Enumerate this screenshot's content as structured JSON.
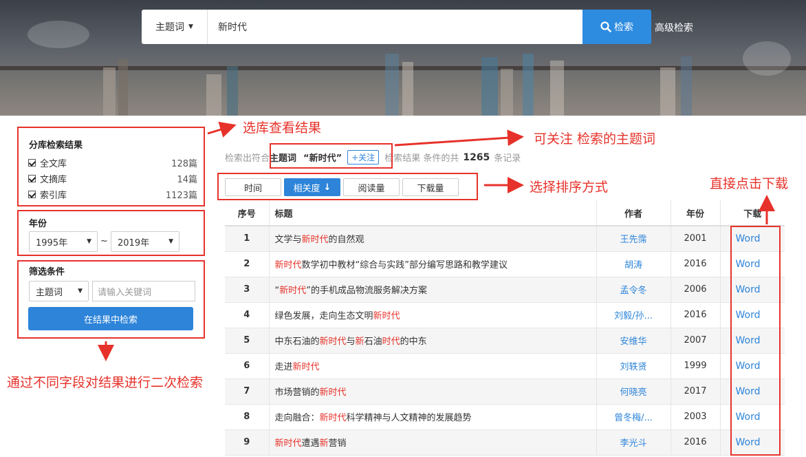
{
  "header": {
    "field_label": "主题词",
    "query": "新时代",
    "search_label": "检索",
    "advanced_label": "高级检索"
  },
  "left": {
    "lib_title": "分库检索结果",
    "libs": [
      {
        "label": "全文库",
        "count": "128篇",
        "checked": true
      },
      {
        "label": "文摘库",
        "count": "14篇",
        "checked": true
      },
      {
        "label": "索引库",
        "count": "1123篇",
        "checked": true
      }
    ],
    "year_title": "年份",
    "year_from": "1995年",
    "year_to": "2019年",
    "year_sep": "~",
    "filter_title": "筛选条件",
    "filter_field": "主题词",
    "filter_placeholder": "请输入关键词",
    "filter_button": "在结果中检索"
  },
  "summary": {
    "prefix": "检索出符合",
    "field": "主题词",
    "term": "“新时代”",
    "follow": "+关注",
    "mid": "检索结果 条件的共",
    "count": "1265",
    "suffix": "条记录"
  },
  "sort": {
    "options": [
      "时间",
      "相关度",
      "阅读量",
      "下载量"
    ],
    "active": "相关度"
  },
  "table": {
    "headers": {
      "no": "序号",
      "title": "标题",
      "author": "作者",
      "year": "年份",
      "download": "下载"
    },
    "rows": [
      {
        "no": "1",
        "title": [
          [
            "文学与",
            false
          ],
          [
            "新时代",
            true
          ],
          [
            "的自然观",
            false
          ]
        ],
        "author": "王先霈",
        "year": "2001",
        "dl": "Word"
      },
      {
        "no": "2",
        "title": [
          [
            "新时代",
            true
          ],
          [
            "数学初中教材“综合与实践”部分编写思路和教学建议",
            false
          ]
        ],
        "author": "胡涛",
        "year": "2016",
        "dl": "Word"
      },
      {
        "no": "3",
        "title": [
          [
            "“",
            false
          ],
          [
            "新时代",
            true
          ],
          [
            "”的手机成品物流服务解决方案",
            false
          ]
        ],
        "author": "孟令冬",
        "year": "2006",
        "dl": "Word"
      },
      {
        "no": "4",
        "title": [
          [
            "绿色发展，走向生态文明",
            false
          ],
          [
            "新时代",
            true
          ]
        ],
        "author": "刘毅/孙...",
        "year": "2016",
        "dl": "Word"
      },
      {
        "no": "5",
        "title": [
          [
            "中东石油的",
            false
          ],
          [
            "新时代",
            true
          ],
          [
            "与",
            false
          ],
          [
            "新",
            true
          ],
          [
            "石油",
            false
          ],
          [
            "时代",
            true
          ],
          [
            "的中东",
            false
          ]
        ],
        "author": "安维华",
        "year": "2007",
        "dl": "Word"
      },
      {
        "no": "6",
        "title": [
          [
            "走进",
            false
          ],
          [
            "新时代",
            true
          ]
        ],
        "author": "刘轶贤",
        "year": "1999",
        "dl": "Word"
      },
      {
        "no": "7",
        "title": [
          [
            "市场营销的",
            false
          ],
          [
            "新时代",
            true
          ]
        ],
        "author": "何晓亮",
        "year": "2017",
        "dl": "Word"
      },
      {
        "no": "8",
        "title": [
          [
            "走向融合：",
            false
          ],
          [
            "新时代",
            true
          ],
          [
            "科学精神与人文精神的发展趋势",
            false
          ]
        ],
        "author": "曾冬梅/...",
        "year": "2003",
        "dl": "Word"
      },
      {
        "no": "9",
        "title": [
          [
            "新时代",
            true
          ],
          [
            "遭遇",
            false
          ],
          [
            "新",
            true
          ],
          [
            "营销",
            false
          ]
        ],
        "author": "李光斗",
        "year": "2016",
        "dl": "Word"
      }
    ]
  },
  "annotations": {
    "lib": "选库查看结果",
    "follow": "可关注 检索的主题词",
    "sort": "选择排序方式",
    "download": "直接点击下载",
    "filter": "通过不同字段对结果进行二次检索"
  },
  "colors": {
    "accent": "#2d84d9",
    "annotation": "#e6322a",
    "highlight": "#e6322a"
  }
}
